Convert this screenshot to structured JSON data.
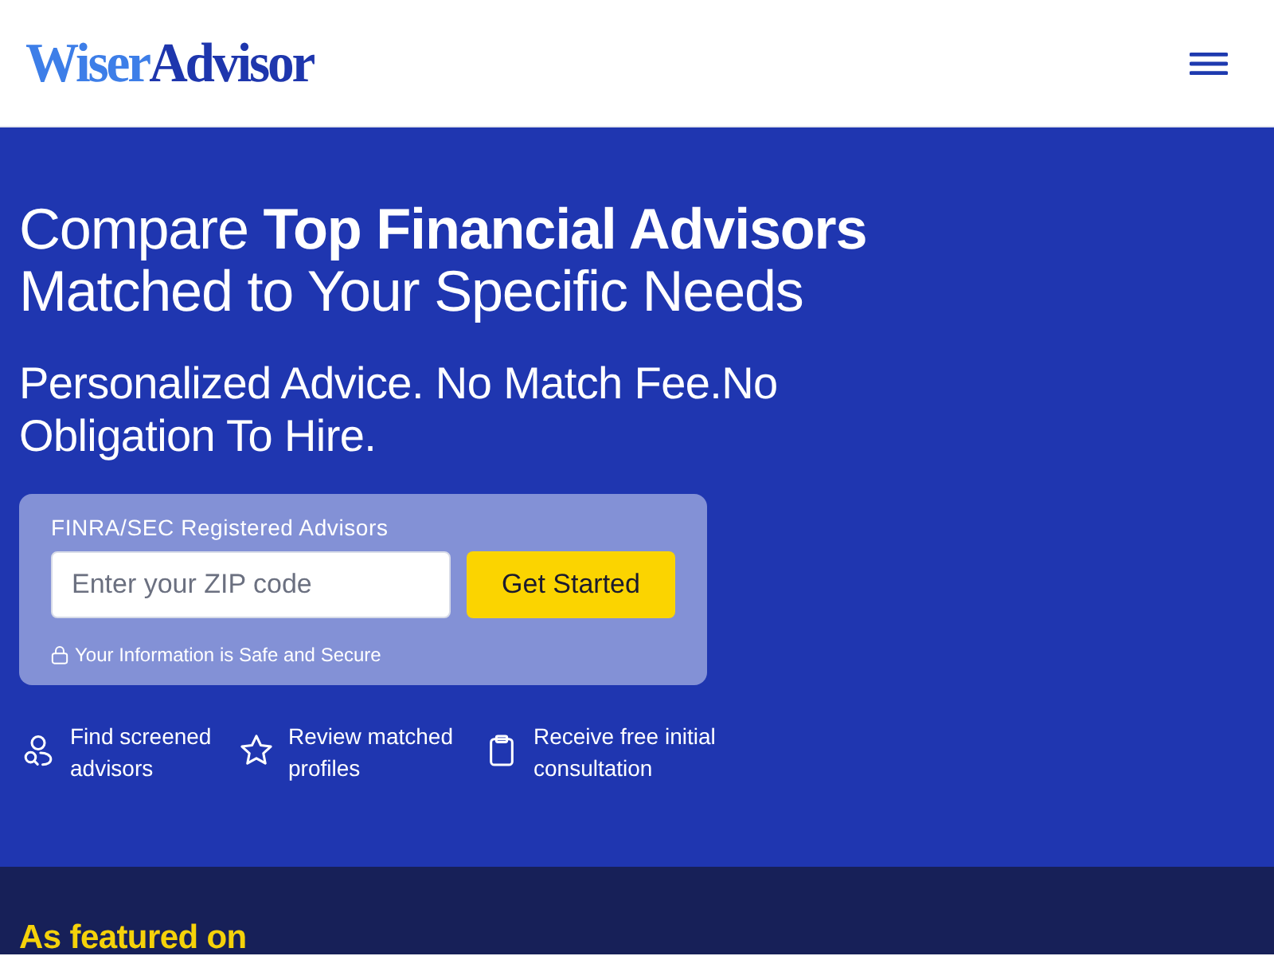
{
  "header": {
    "logo": [
      "Wiser",
      "Advisor"
    ]
  },
  "hero": {
    "headline": "Compare **Top Financial Advisors** Matched to Your Specific Needs",
    "subheadline": "Personalized Advice. No Match Fee.No Obligation To Hire.",
    "form": {
      "label": "FINRA/SEC Registered Advisors",
      "zip_field": {
        "placeholder": "Enter your ZIP code"
      },
      "button": "Get Started",
      "note": "Your Information is Safe and Secure"
    },
    "features": [
      {
        "text": "Find screened advisors"
      },
      {
        "text": "Review matched profiles"
      },
      {
        "text": "Receive free initial consultation"
      }
    ]
  },
  "featured": {
    "title": "As featured on"
  }
}
